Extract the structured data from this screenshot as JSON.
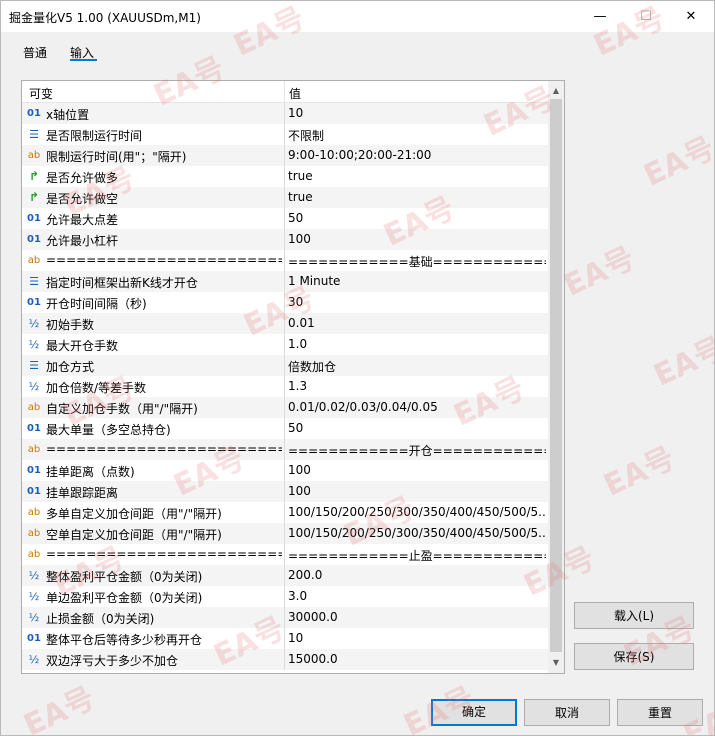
{
  "window": {
    "title": "掘金量化V5 1.00 (XAUUSDm,M1)",
    "min_glyph": "—",
    "max_glyph": "☐",
    "close_glyph": "✕"
  },
  "tabs": [
    {
      "label": "普通"
    },
    {
      "label": "输入"
    }
  ],
  "grid": {
    "header": {
      "col1": "可变",
      "col2": "值"
    },
    "rows": [
      {
        "icon": "01",
        "name": "x轴位置",
        "value": "10"
      },
      {
        "icon": "list",
        "name": "是否限制运行时间",
        "value": "不限制"
      },
      {
        "icon": "ab",
        "name": "限制运行时间(用\"；\"隔开)",
        "value": "9:00-10:00;20:00-21:00"
      },
      {
        "icon": "arrow",
        "name": "是否允许做多",
        "value": "true"
      },
      {
        "icon": "arrow",
        "name": "是否允许做空",
        "value": "true"
      },
      {
        "icon": "01",
        "name": "允许最大点差",
        "value": "50"
      },
      {
        "icon": "01",
        "name": "允许最小杠杆",
        "value": "100"
      },
      {
        "icon": "ab",
        "name": "==============================...",
        "value": "============基础============"
      },
      {
        "icon": "list",
        "name": "指定时间框架出新K线才开仓",
        "value": "1 Minute"
      },
      {
        "icon": "01",
        "name": "开仓时间间隔（秒)",
        "value": "30"
      },
      {
        "icon": "half",
        "name": "初始手数",
        "value": "0.01"
      },
      {
        "icon": "half",
        "name": "最大开仓手数",
        "value": "1.0"
      },
      {
        "icon": "list",
        "name": "加仓方式",
        "value": "倍数加仓"
      },
      {
        "icon": "half",
        "name": "加仓倍数/等差手数",
        "value": "1.3"
      },
      {
        "icon": "ab",
        "name": "自定义加仓手数（用\"/\"隔开)",
        "value": "0.01/0.02/0.03/0.04/0.05"
      },
      {
        "icon": "01",
        "name": "最大单量（多空总持仓)",
        "value": "50"
      },
      {
        "icon": "ab",
        "name": "==============================...",
        "value": "============开仓============"
      },
      {
        "icon": "01",
        "name": "挂单距离（点数)",
        "value": "100"
      },
      {
        "icon": "01",
        "name": "挂单跟踪距离",
        "value": "100"
      },
      {
        "icon": "ab",
        "name": "多单自定义加仓间距（用\"/\"隔开)",
        "value": "100/150/200/250/300/350/400/450/500/5..."
      },
      {
        "icon": "ab",
        "name": "空单自定义加仓间距（用\"/\"隔开)",
        "value": "100/150/200/250/300/350/400/450/500/5..."
      },
      {
        "icon": "ab",
        "name": "==============================...",
        "value": "============止盈============"
      },
      {
        "icon": "half",
        "name": "整体盈利平仓金额（0为关闭)",
        "value": "200.0"
      },
      {
        "icon": "half",
        "name": "单边盈利平仓金额（0为关闭)",
        "value": "3.0"
      },
      {
        "icon": "half",
        "name": "止损金额（0为关闭)",
        "value": "30000.0"
      },
      {
        "icon": "01",
        "name": "整体平仓后等待多少秒再开仓",
        "value": "10"
      },
      {
        "icon": "half",
        "name": "双边浮亏大于多少不加仓",
        "value": "15000.0"
      }
    ]
  },
  "buttons": {
    "load": "载入(L)",
    "save": "保存(S)",
    "ok": "确定",
    "cancel": "取消",
    "reset": "重置"
  },
  "watermark": "EA号",
  "colors": {
    "accent": "#0078d7",
    "watermark": "#e67878"
  }
}
